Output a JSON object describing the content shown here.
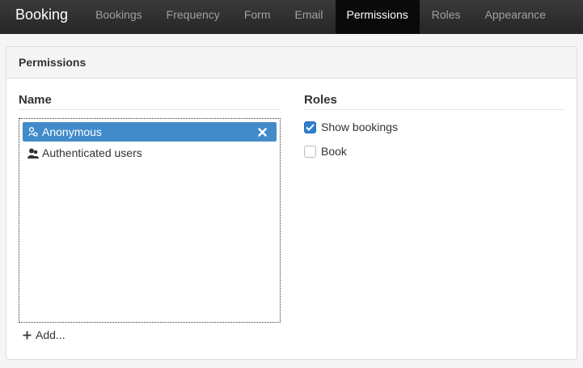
{
  "navbar": {
    "brand": "Booking",
    "items": [
      {
        "label": "Bookings"
      },
      {
        "label": "Frequency"
      },
      {
        "label": "Form"
      },
      {
        "label": "Email"
      },
      {
        "label": "Permissions",
        "active": true
      },
      {
        "label": "Roles"
      },
      {
        "label": "Appearance"
      }
    ]
  },
  "panel": {
    "title": "Permissions",
    "name_column_title": "Name",
    "roles_column_title": "Roles",
    "list": [
      {
        "label": "Anonymous",
        "icon": "anonymous-user-icon",
        "selected": true
      },
      {
        "label": "Authenticated users",
        "icon": "users-icon",
        "selected": false
      }
    ],
    "add_label": "Add...",
    "roles": [
      {
        "label": "Show bookings",
        "checked": true
      },
      {
        "label": "Book",
        "checked": false
      }
    ]
  },
  "colors": {
    "navbar_bg": "#2e2e2e",
    "active_tab_bg": "#0a0a0a",
    "selected_row": "#428bca",
    "checkbox_checked": "#2f7fd0"
  }
}
